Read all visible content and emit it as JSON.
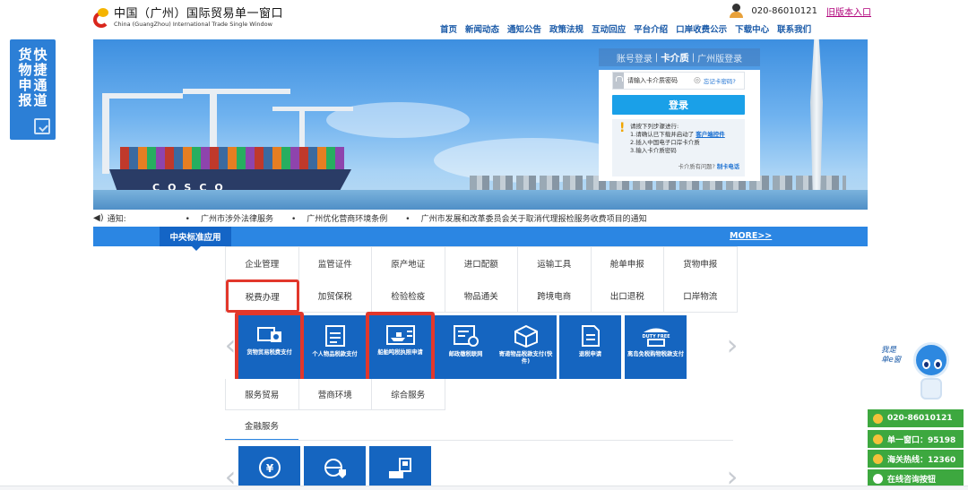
{
  "header": {
    "logo_cn": "中国（广州）国际贸易单一窗口",
    "logo_en": "China (GuangZhou) International Trade Single Window",
    "phone": "020-86010121",
    "old_version_link": "旧版本入口",
    "nav": [
      "首页",
      "新闻动态",
      "通知公告",
      "政策法规",
      "互动回应",
      "平台介绍",
      "口岸收费公示",
      "下载中心",
      "联系我们"
    ]
  },
  "float_left": {
    "col1": [
      "货",
      "物",
      "申",
      "报"
    ],
    "col2": [
      "快",
      "捷",
      "通",
      "道"
    ]
  },
  "banner": {
    "ship_text": "COSCO"
  },
  "login": {
    "tabs": [
      "账号登录",
      "卡介质",
      "广州版登录"
    ],
    "password_placeholder": "请输入卡介质密码",
    "forgot": "忘记卡密码?",
    "login_button": "登录",
    "steps_title": "请按下列步骤进行:",
    "step1": "1.请确认已下载并启动了",
    "step1_link": "客户端控件",
    "step2": "2.插入中国电子口岸卡介质",
    "step3": "3.输入卡介质密码",
    "trouble": "卡介质有问题?",
    "trouble_link": "制卡电话"
  },
  "notice": {
    "label": "通知:",
    "items": [
      "广州市涉外法律服务",
      "广州优化营商环境条例",
      "广州市发展和改革委员会关于取消代理报检服务收费项目的通知"
    ]
  },
  "tabbar": {
    "central": "中央标准应用",
    "more": "MORE>>"
  },
  "categories": {
    "row1": [
      "企业管理",
      "监管证件",
      "原产地证",
      "进口配额",
      "运输工具",
      "舱单申报",
      "货物申报"
    ],
    "row2": [
      "税费办理",
      "加贸保税",
      "检验检疫",
      "物品通关",
      "跨境电商",
      "出口退税",
      "口岸物流"
    ],
    "row3": [
      "服务贸易",
      "营商环境",
      "综合服务"
    ],
    "finance_tab": "金融服务"
  },
  "tiles": [
    {
      "label": "货物贸易税费支付",
      "icon": "cash-payment-icon"
    },
    {
      "label": "个人物品税款支付",
      "icon": "tax-form-icon"
    },
    {
      "label": "船舶吨税执照申请",
      "icon": "ship-license-icon"
    },
    {
      "label": "邮政缴税联网",
      "icon": "post-tax-icon"
    },
    {
      "label": "寄递物品税款支付(快件)",
      "icon": "parcel-icon"
    },
    {
      "label": "退税申请",
      "icon": "refund-document-icon"
    },
    {
      "label": "离岛免税购物税款支付",
      "icon": "duty-free-shop-icon",
      "badge": "DUTY FREE"
    }
  ],
  "mascot": {
    "line1": "我是",
    "line2": "单e窗"
  },
  "contacts": [
    "020-86010121",
    "单一窗口：95198",
    "海关热线：12360",
    "在线咨询按钮"
  ],
  "colors": {
    "primary": "#2b86e3",
    "dark_blue": "#1565c0",
    "highlight": "#e2372b",
    "contact_green": "#3da83f"
  }
}
